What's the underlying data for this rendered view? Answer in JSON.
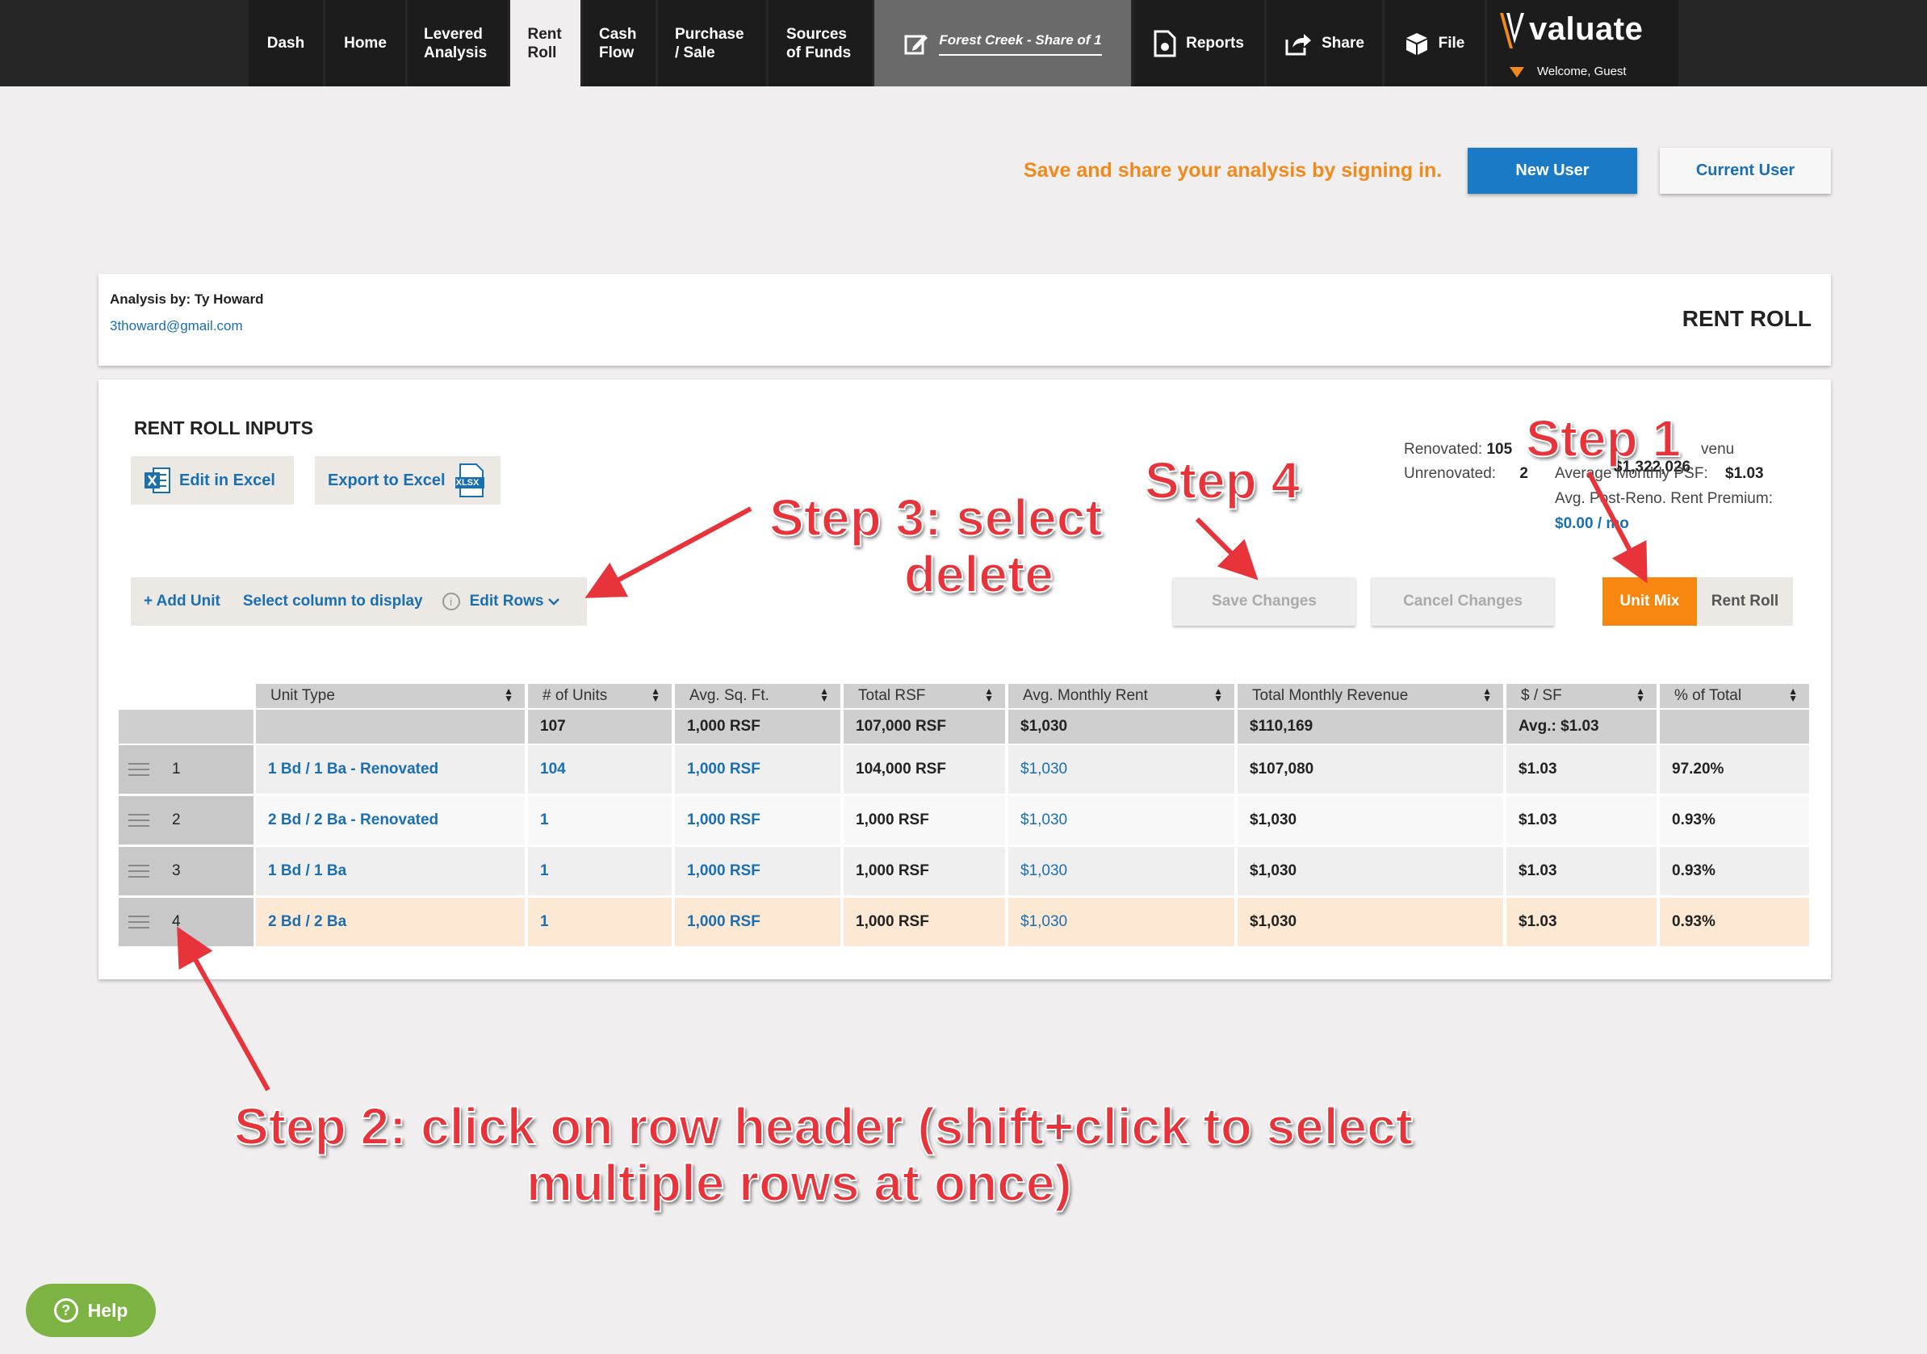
{
  "nav": {
    "tabs": [
      {
        "label": "Dash"
      },
      {
        "label": "Home"
      },
      {
        "label": "Levered Analysis"
      },
      {
        "label": "Rent Roll"
      },
      {
        "label": "Cash Flow"
      },
      {
        "label": "Purchase / Sale"
      },
      {
        "label": "Sources of Funds"
      }
    ],
    "property": "Forest Creek  - Share of 1",
    "reports": "Reports",
    "share": "Share",
    "file": "File",
    "brand": "valuate",
    "welcome": "Welcome, Guest"
  },
  "signin": {
    "message": "Save and share your analysis by signing in.",
    "new_user": "New User",
    "current_user": "Current User"
  },
  "header": {
    "analysis_by": "Analysis by: Ty Howard",
    "email": "3thoward@gmail.com",
    "page_title": "RENT ROLL"
  },
  "inputs": {
    "title": "RENT ROLL INPUTS",
    "edit_excel": "Edit in Excel",
    "export_excel": "Export to Excel",
    "xlsx_badge": "XLSX",
    "add_unit": "+ Add Unit",
    "select_column": "Select column to display",
    "info_icon": "i",
    "edit_rows": "Edit Rows",
    "save": "Save Changes",
    "cancel": "Cancel Changes",
    "unit_mix": "Unit Mix",
    "rent_roll": "Rent Roll"
  },
  "stats": {
    "renovated_label": "Renovated:",
    "renovated_value": "105",
    "unrenovated_label": "Unrenovated:",
    "unrenovated_value": "2",
    "revenue_label_fragment": "venu",
    "revenue_value": "$1,322,026",
    "psf_label": "Average Monthly PSF:",
    "psf_value": "$1.03",
    "premium_label": "Avg. Post-Reno. Rent Premium:",
    "premium_value": "$0.00 / mo"
  },
  "table": {
    "columns": [
      "Unit Type",
      "# of Units",
      "Avg. Sq. Ft.",
      "Total RSF",
      "Avg. Monthly Rent",
      "Total Monthly Revenue",
      "$ / SF",
      "% of Total"
    ],
    "totals": [
      "",
      "107",
      "1,000 RSF",
      "107,000 RSF",
      "$1,030",
      "$110,169",
      "Avg.: $1.03",
      ""
    ],
    "rows": [
      {
        "n": "1",
        "cells": [
          "1 Bd / 1 Ba - Renovated",
          "104",
          "1,000 RSF",
          "104,000 RSF",
          "$1,030",
          "$107,080",
          "$1.03",
          "97.20%"
        ]
      },
      {
        "n": "2",
        "cells": [
          "2 Bd / 2 Ba - Renovated",
          "1",
          "1,000 RSF",
          "1,000 RSF",
          "$1,030",
          "$1,030",
          "$1.03",
          "0.93%"
        ]
      },
      {
        "n": "3",
        "cells": [
          "1 Bd / 1 Ba",
          "1",
          "1,000 RSF",
          "1,000 RSF",
          "$1,030",
          "$1,030",
          "$1.03",
          "0.93%"
        ]
      },
      {
        "n": "4",
        "cells": [
          "2 Bd / 2 Ba",
          "1",
          "1,000 RSF",
          "1,000 RSF",
          "$1,030",
          "$1,030",
          "$1.03",
          "0.93%"
        ]
      }
    ]
  },
  "annotations": {
    "step1": "Step 1",
    "step2_line1": "Step 2: click on row header (shift+click to select",
    "step2_line2": "multiple rows at once)",
    "step3_line1": "Step 3: select",
    "step3_line2": "delete",
    "step4": "Step 4"
  },
  "help": "Help",
  "colors": {
    "accent": "#f08a1c",
    "link": "#1a6fb0",
    "annotation": "#e8333a",
    "selected_row": "#fde8d3"
  }
}
